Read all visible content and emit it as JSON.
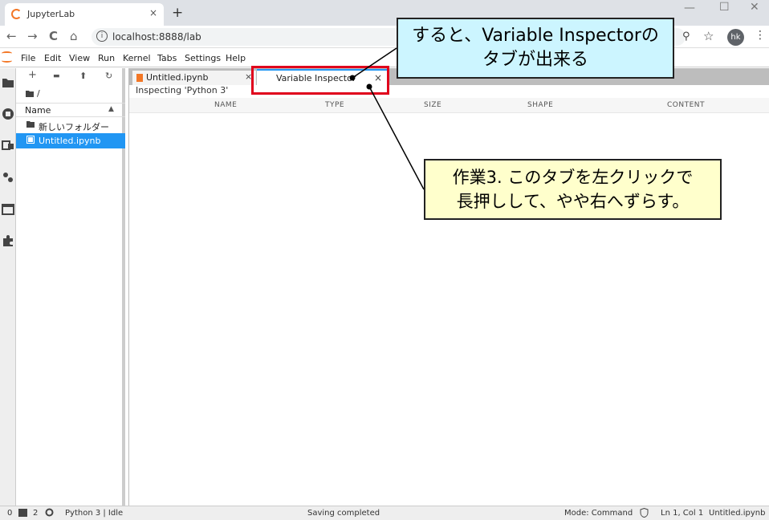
{
  "browser": {
    "tab_title": "JupyterLab",
    "tab_close": "×",
    "new_tab": "+",
    "url": "localhost:8888/lab",
    "avatar_initials": "hk",
    "window_min": "—",
    "window_max": "☐",
    "window_close": "✕",
    "nav": {
      "back": "←",
      "forward": "→",
      "reload": "C",
      "home": "⌂",
      "info": "i",
      "zoom": "⚲",
      "star": "☆",
      "menu": "⋮"
    }
  },
  "menubar": {
    "items": [
      "File",
      "Edit",
      "View",
      "Run",
      "Kernel",
      "Tabs",
      "Settings",
      "Help"
    ]
  },
  "sidebar_icons": [
    "folder-icon",
    "running-icon",
    "commands-icon",
    "property-inspector-icon",
    "tabs-icon",
    "extension-icon"
  ],
  "file_browser": {
    "toolbar": {
      "new_launcher": "+",
      "new_folder": "▬",
      "upload": "⬆",
      "refresh": "↻"
    },
    "path": "/",
    "header_name": "Name",
    "sort_indicator": "▲",
    "rows": [
      {
        "name": "新しいフォルダー",
        "type": "folder"
      },
      {
        "name": "Untitled.ipynb",
        "type": "notebook",
        "selected": true
      }
    ]
  },
  "dock_tabs": [
    {
      "label": "Untitled.ipynb",
      "close": "×"
    },
    {
      "label": "Variable Inspector",
      "close": "×",
      "active": true
    }
  ],
  "variable_inspector": {
    "inspecting": "Inspecting 'Python 3'",
    "columns": [
      "NAME",
      "TYPE",
      "SIZE",
      "SHAPE",
      "CONTENT"
    ]
  },
  "statusbar": {
    "count0": "0",
    "terminal_count": "2",
    "kernel": "Python 3 | Idle",
    "saving": "Saving completed",
    "mode": "Mode: Command",
    "cursor": "Ln 1, Col 1",
    "file": "Untitled.ipynb"
  },
  "annotations": {
    "callout1_line1": "すると、Variable Inspectorの",
    "callout1_line2": "タブが出来る",
    "callout2_line1": "作業3. このタブを左クリックで",
    "callout2_line2": "長押しして、やや右へずらす。"
  },
  "colors": {
    "accent": "#2196f3",
    "jupyter_orange": "#f37726",
    "highlight_red": "#e0001c",
    "callout_blue": "#ccf5ff",
    "callout_yellow": "#ffffcc"
  }
}
